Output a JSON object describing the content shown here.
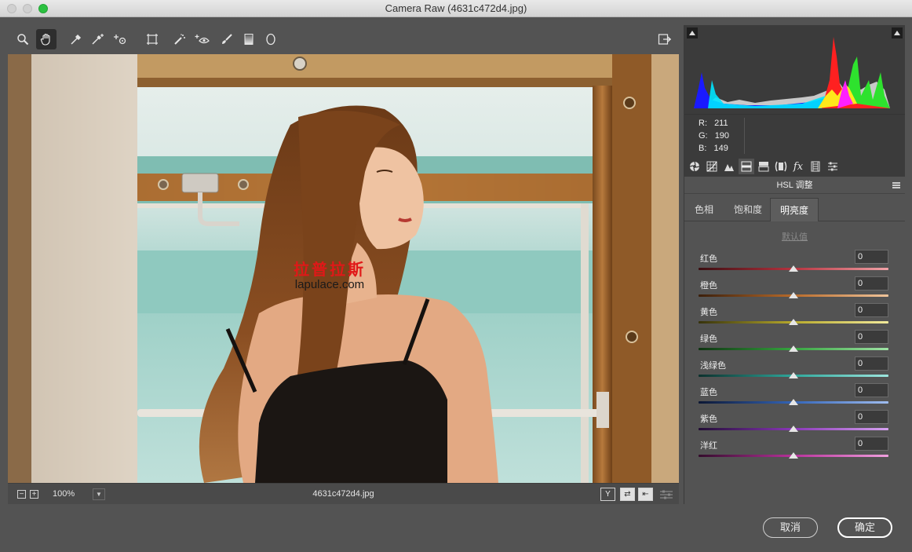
{
  "window": {
    "title": "Camera Raw (4631c472d4.jpg)"
  },
  "toolbar": {
    "tools": [
      "zoom-icon",
      "hand-icon",
      "white-balance-icon",
      "color-sampler-icon",
      "targeted-adjustment-icon",
      "transform-icon",
      "spot-removal-icon",
      "red-eye-icon",
      "adjustment-brush-icon",
      "graduated-filter-icon",
      "radial-filter-icon"
    ],
    "open_preferences_icon": "export-icon"
  },
  "watermark": {
    "cn": "拉普拉斯",
    "url": "lapulace.com"
  },
  "status": {
    "zoom_out": "−",
    "zoom_in": "+",
    "zoom_level": "100%",
    "filename": "4631c472d4.jpg",
    "view_buttons": [
      "Y",
      "⇄",
      "⇤"
    ]
  },
  "rgb_readout": {
    "r_label": "R:",
    "r": "211",
    "g_label": "G:",
    "g": "190",
    "b_label": "B:",
    "b": "149"
  },
  "panel": {
    "section_title": "HSL 调整",
    "subtabs": [
      "色相",
      "饱和度",
      "明亮度"
    ],
    "active_subtab": "明亮度",
    "default_link": "默认值",
    "sliders": [
      {
        "label": "红色",
        "value": "0",
        "gradient": "#3a0d10,#b7333f,#f1a3a8"
      },
      {
        "label": "橙色",
        "value": "0",
        "gradient": "#3b1f0b,#b86b2b,#f0c49a"
      },
      {
        "label": "黄色",
        "value": "0",
        "gradient": "#36320b,#b8aa2c,#f2ea9b"
      },
      {
        "label": "绿色",
        "value": "0",
        "gradient": "#0e3311,#36a53f,#9fe3a5"
      },
      {
        "label": "浅绿色",
        "value": "0",
        "gradient": "#0c312d,#2fa79b,#9de6de"
      },
      {
        "label": "蓝色",
        "value": "0",
        "gradient": "#0c1734,#3465b8,#9fbdf0"
      },
      {
        "label": "紫色",
        "value": "0",
        "gradient": "#210c34,#8a37b8,#d6a2f0"
      },
      {
        "label": "洋红",
        "value": "0",
        "gradient": "#340c2c,#b8329b,#f0a0de"
      }
    ]
  },
  "footer": {
    "cancel": "取消",
    "ok": "确定"
  }
}
